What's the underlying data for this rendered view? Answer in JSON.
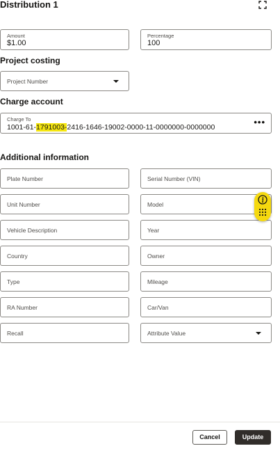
{
  "header": {
    "title": "Distribution 1",
    "expand_icon": "expand-icon"
  },
  "amount": {
    "label": "Amount",
    "value": "$1.00"
  },
  "percentage": {
    "label": "Percentage",
    "value": "100"
  },
  "project_costing": {
    "heading": "Project costing",
    "project_number_placeholder": "Project Number"
  },
  "charge_account": {
    "heading": "Charge account",
    "label": "Charge To",
    "value_prefix": "1001-61-",
    "value_highlight": "1791003-",
    "value_suffix": "2416-1646-19002-0000-11-0000000-0000000",
    "more_label": "•••"
  },
  "additional": {
    "heading": "Additional information",
    "fields": {
      "plate_number": "Plate Number",
      "serial_number": "Serial Number (VIN)",
      "unit_number": "Unit Number",
      "model": "Model",
      "vehicle_description": "Vehicle Description",
      "year": "Year",
      "country": "Country",
      "owner": "Owner",
      "type": "Type",
      "mileage": "Mileage",
      "ra_number": "RA Number",
      "car_van": "Car/Van",
      "recall": "Recall",
      "attribute_value": "Attribute Value"
    }
  },
  "footer": {
    "cancel_label": "Cancel",
    "update_label": "Update"
  },
  "colors": {
    "accent": "#312d2a",
    "highlight": "#f5e60f",
    "helper": "#f5d90f",
    "border": "#8b8985"
  }
}
